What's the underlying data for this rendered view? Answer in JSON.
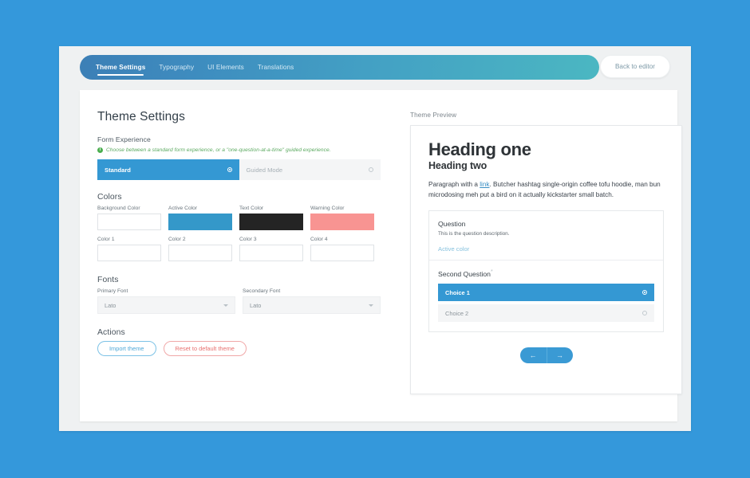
{
  "colors": {
    "page_background": "#3498db",
    "frame_background": "#eff1f2",
    "accent_blue": "#3498d3",
    "tab_gradient_start": "#3c7fb6",
    "tab_gradient_end": "#4bb7c2",
    "help_green": "#5aa95f",
    "danger_red": "#e8706f"
  },
  "topbar": {
    "tabs": [
      {
        "label": "Theme Settings",
        "active": true
      },
      {
        "label": "Typography",
        "active": false
      },
      {
        "label": "UI Elements",
        "active": false
      },
      {
        "label": "Translations",
        "active": false
      }
    ],
    "back_button": "Back to editor"
  },
  "settings": {
    "page_title": "Theme Settings",
    "form_experience": {
      "section_title": "Form Experience",
      "help_text": "Choose between a standard form experience, or a \"one-question-at-a-time\" guided experience.",
      "info_glyph": "i",
      "options": [
        {
          "label": "Standard",
          "selected": true
        },
        {
          "label": "Guided Mode",
          "selected": false
        }
      ]
    },
    "colors_section": {
      "section_title": "Colors",
      "fields": [
        {
          "label": "Background Color",
          "value": ""
        },
        {
          "label": "Active Color",
          "value": "#3498c9"
        },
        {
          "label": "Text Color",
          "value": "#242424"
        },
        {
          "label": "Warning Color",
          "value": "#f89492"
        },
        {
          "label": "Color 1",
          "value": ""
        },
        {
          "label": "Color 2",
          "value": ""
        },
        {
          "label": "Color 3",
          "value": ""
        },
        {
          "label": "Color 4",
          "value": ""
        }
      ]
    },
    "fonts_section": {
      "section_title": "Fonts",
      "fields": [
        {
          "label": "Primary Font",
          "value": "Lato"
        },
        {
          "label": "Secondary Font",
          "value": "Lato"
        }
      ]
    },
    "actions_section": {
      "section_title": "Actions",
      "buttons": [
        {
          "label": "Import theme",
          "style": "blue"
        },
        {
          "label": "Reset to default theme",
          "style": "red"
        }
      ]
    }
  },
  "preview": {
    "label": "Theme Preview",
    "heading_one": "Heading one",
    "heading_two": "Heading two",
    "paragraph_before_link": "Paragraph with a ",
    "paragraph_link": "link",
    "paragraph_after_link": ". Butcher hashtag single-origin coffee tofu hoodie, man bun microdosing meh put a bird on it actually kickstarter small batch.",
    "question_one": {
      "title": "Question",
      "description": "This is the question description.",
      "link": "Active color"
    },
    "question_two": {
      "title": "Second Question",
      "required_marker": "*",
      "choices": [
        {
          "label": "Choice 1",
          "selected": true
        },
        {
          "label": "Choice 2",
          "selected": false
        }
      ]
    },
    "nav": {
      "prev_icon": "←",
      "next_icon": "→"
    }
  }
}
